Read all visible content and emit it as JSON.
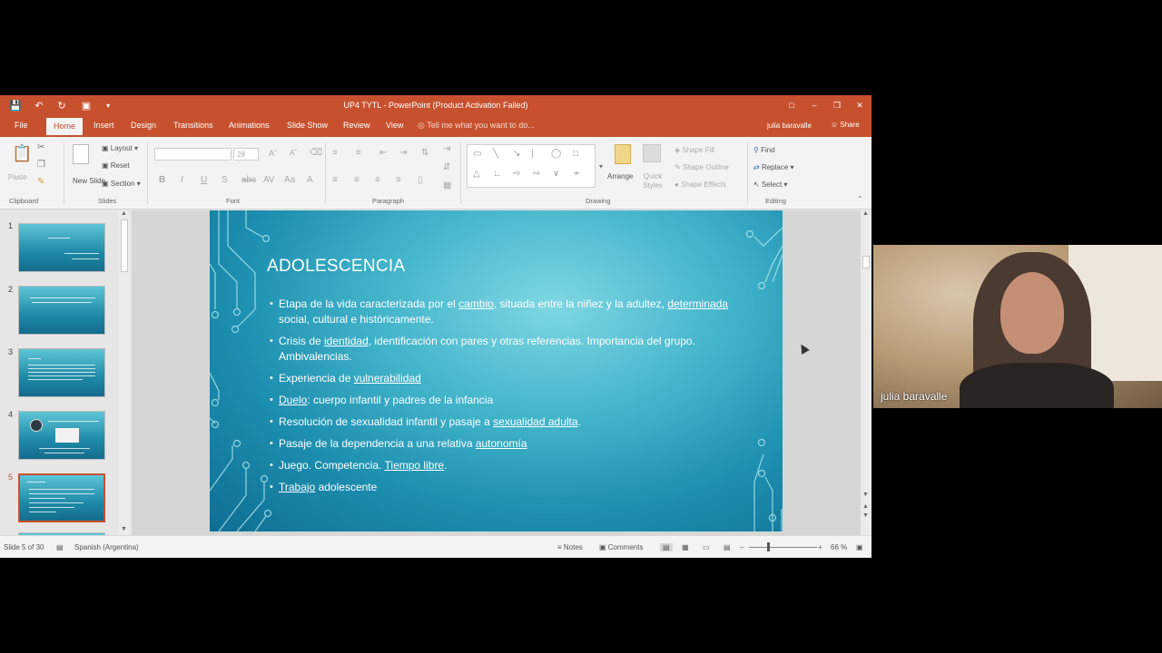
{
  "titlebar": {
    "doc_title": "UP4 TYTL - PowerPoint (Product Activation Failed)",
    "qa_icons": [
      "save-icon",
      "undo-icon",
      "redo-icon",
      "customize-icon"
    ],
    "colors": {
      "accent": "#c7512e"
    }
  },
  "tabs": [
    "File",
    "Home",
    "Insert",
    "Design",
    "Transitions",
    "Animations",
    "Slide Show",
    "Review",
    "View"
  ],
  "active_tab": "Home",
  "tell_me": "Tell me what you want to do...",
  "user": "julia baravalle",
  "share": "Share",
  "ribbon": {
    "clipboard": {
      "paste": "Paste",
      "label": "Clipboard"
    },
    "slides": {
      "new_slide": "New Slide",
      "layout": "Layout",
      "reset": "Reset",
      "section": "Section",
      "label": "Slides"
    },
    "font": {
      "size": "28",
      "label": "Font",
      "bold": "B",
      "italic": "I",
      "underline": "U",
      "strike": "S",
      "aa": "Aa",
      "a": "A"
    },
    "paragraph": {
      "label": "Paragraph"
    },
    "drawing": {
      "arrange": "Arrange",
      "quick_styles": "Quick Styles",
      "shape_fill": "Shape Fill",
      "shape_outline": "Shape Outline",
      "shape_effects": "Shape Effects",
      "label": "Drawing"
    },
    "editing": {
      "find": "Find",
      "replace": "Replace",
      "select": "Select",
      "label": "Editing"
    }
  },
  "thumbnails": [
    {
      "num": "1"
    },
    {
      "num": "2"
    },
    {
      "num": "3"
    },
    {
      "num": "4"
    },
    {
      "num": "5"
    }
  ],
  "selected_slide": 5,
  "slide": {
    "title": "ADOLESCENCIA",
    "bullets": [
      {
        "parts": [
          "Etapa de la vida caracterizada por el ",
          "cambio",
          ", situada entre la niñez y la adultez, ",
          "determinada",
          " social, cultural e históricamente."
        ]
      },
      {
        "parts": [
          "Crisis de ",
          "identidad",
          ", identificación con pares y otras referencias. Importancia del grupo. Ambivalencias."
        ]
      },
      {
        "parts": [
          "Experiencia de ",
          "vulnerabilidad",
          ""
        ]
      },
      {
        "parts": [
          "",
          "Duelo",
          ": cuerpo infantil y padres de la infancia"
        ]
      },
      {
        "parts": [
          "Resolución de sexualidad infantil y pasaje a ",
          "sexualidad adulta",
          "."
        ]
      },
      {
        "parts": [
          "Pasaje de la dependencia a una relativa ",
          "autonomía",
          ""
        ]
      },
      {
        "parts": [
          "Juego. Competencia. ",
          "Tiempo libre",
          "."
        ]
      },
      {
        "parts": [
          "",
          "Trabajo",
          " adolescente"
        ]
      }
    ]
  },
  "statusbar": {
    "slide_count": "Slide 5 of 30",
    "language": "Spanish (Argentina)",
    "notes": "Notes",
    "comments": "Comments",
    "zoom": "66 %"
  },
  "video": {
    "name": "julia baravalle"
  }
}
